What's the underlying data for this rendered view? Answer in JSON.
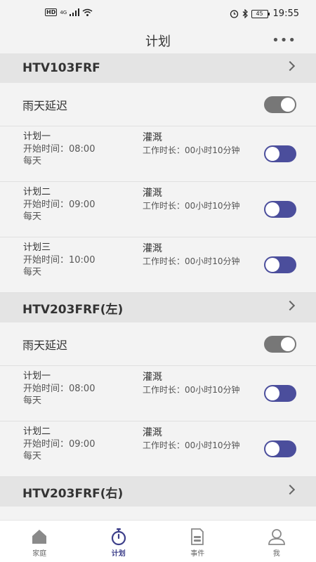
{
  "status_bar": {
    "hd": "HD",
    "network": "4G",
    "battery": "45",
    "time": "19:55"
  },
  "header": {
    "title": "计划",
    "more": "•••"
  },
  "devices": [
    {
      "name": "HTV103FRF",
      "rain_delay": {
        "label": "雨天延迟",
        "enabled": false
      },
      "plans": [
        {
          "name": "计划一",
          "start": "开始时间：08:00",
          "repeat": "每天",
          "type": "灌溉",
          "duration": "工作时长：00小时10分钟",
          "enabled": true
        },
        {
          "name": "计划二",
          "start": "开始时间：09:00",
          "repeat": "每天",
          "type": "灌溉",
          "duration": "工作时长：00小时10分钟",
          "enabled": true
        },
        {
          "name": "计划三",
          "start": "开始时间：10:00",
          "repeat": "每天",
          "type": "灌溉",
          "duration": "工作时长：00小时10分钟",
          "enabled": true
        }
      ]
    },
    {
      "name": "HTV203FRF(左)",
      "rain_delay": {
        "label": "雨天延迟",
        "enabled": false
      },
      "plans": [
        {
          "name": "计划一",
          "start": "开始时间：08:00",
          "repeat": "每天",
          "type": "灌溉",
          "duration": "工作时长：00小时10分钟",
          "enabled": true
        },
        {
          "name": "计划二",
          "start": "开始时间：09:00",
          "repeat": "每天",
          "type": "灌溉",
          "duration": "工作时长：00小时10分钟",
          "enabled": true
        }
      ]
    },
    {
      "name": "HTV203FRF(右)"
    }
  ],
  "tabs": [
    {
      "label": "家庭",
      "icon": "home-icon",
      "active": false
    },
    {
      "label": "计划",
      "icon": "stopwatch-icon",
      "active": true
    },
    {
      "label": "事件",
      "icon": "document-icon",
      "active": false
    },
    {
      "label": "我",
      "icon": "user-icon",
      "active": false
    }
  ],
  "colors": {
    "accent": "#4b4e9c",
    "toggle_off": "#777777",
    "section_bg": "#e4e4e4",
    "page_bg": "#f3f3f3"
  }
}
